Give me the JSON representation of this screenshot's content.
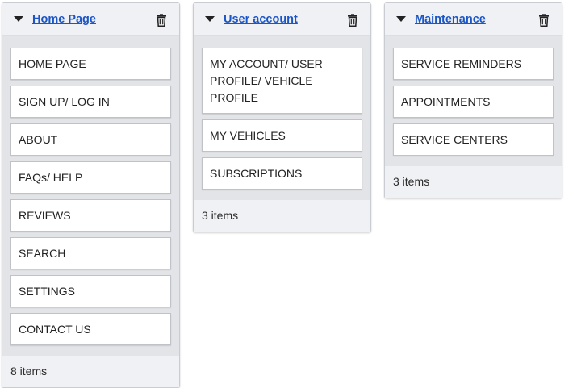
{
  "columns": [
    {
      "title": "Home Page",
      "items": [
        "HOME PAGE",
        "SIGN UP/ LOG IN",
        "ABOUT",
        "FAQs/ HELP",
        "REVIEWS",
        "SEARCH",
        "SETTINGS",
        "CONTACT US"
      ],
      "count_label": "8 items"
    },
    {
      "title": "User account",
      "items": [
        "MY ACCOUNT/ USER PROFILE/ VEHICLE PROFILE",
        "MY VEHICLES",
        "SUBSCRIPTIONS"
      ],
      "count_label": "3 items"
    },
    {
      "title": "Maintenance",
      "items": [
        "SERVICE REMINDERS",
        "APPOINTMENTS",
        "SERVICE CENTERS"
      ],
      "count_label": "3 items"
    }
  ],
  "icons": {
    "toggle": "caret-down-icon",
    "delete": "trash-icon"
  },
  "colors": {
    "title_link": "#1a56c8",
    "column_bg": "#f0f1f4",
    "items_bg": "#e2e4e8"
  }
}
